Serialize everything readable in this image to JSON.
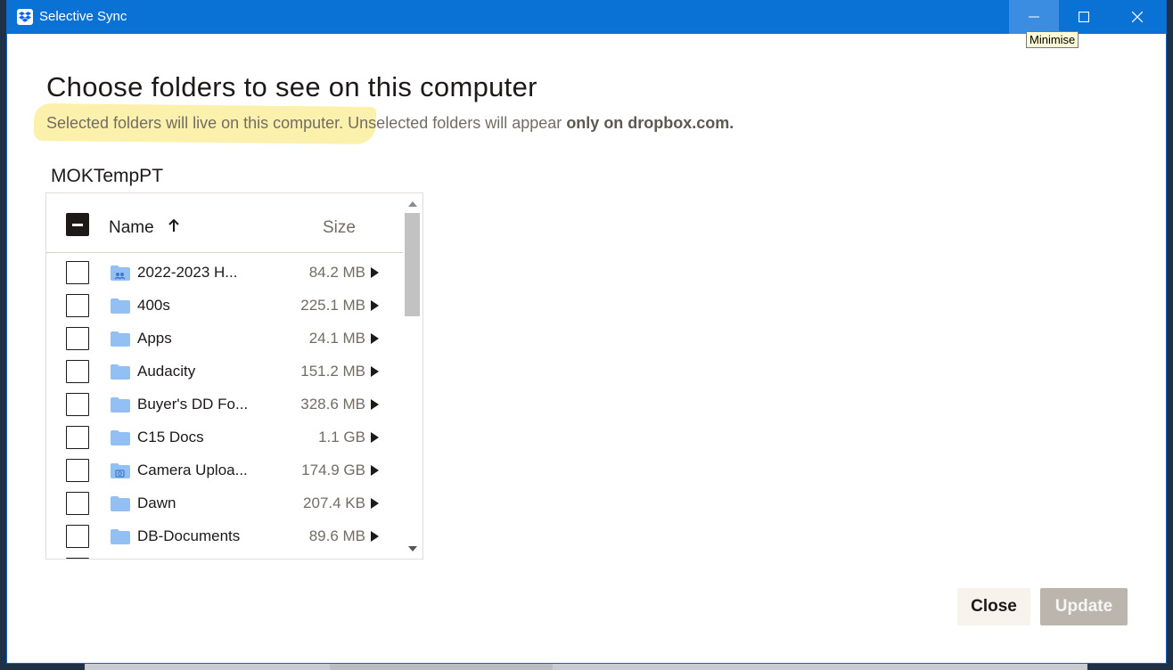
{
  "window": {
    "title": "Selective Sync",
    "tooltip": "Minimise"
  },
  "header": {
    "heading": "Choose folders to see on this computer",
    "subtitle_part1": "Selected folders will live on this computer.",
    "subtitle_part2": " Unselected folders will appear ",
    "subtitle_bold": "only on dropbox.com."
  },
  "account": "MOKTempPT",
  "table": {
    "col_name": "Name",
    "col_size": "Size",
    "rows": [
      {
        "name": "2022-2023 H...",
        "size": "84.2 MB",
        "icon": "shared-folder-icon"
      },
      {
        "name": "400s",
        "size": "225.1 MB",
        "icon": "folder-icon"
      },
      {
        "name": "Apps",
        "size": "24.1 MB",
        "icon": "folder-icon"
      },
      {
        "name": "Audacity",
        "size": "151.2 MB",
        "icon": "folder-icon"
      },
      {
        "name": "Buyer's DD Fo...",
        "size": "328.6 MB",
        "icon": "folder-icon"
      },
      {
        "name": "C15 Docs",
        "size": "1.1 GB",
        "icon": "folder-icon"
      },
      {
        "name": "Camera Uploa...",
        "size": "174.9 GB",
        "icon": "camera-folder-icon"
      },
      {
        "name": "Dawn",
        "size": "207.4 KB",
        "icon": "folder-icon"
      },
      {
        "name": "DB-Documents",
        "size": "89.6 MB",
        "icon": "folder-icon"
      }
    ]
  },
  "buttons": {
    "close": "Close",
    "update": "Update"
  },
  "colors": {
    "titlebar": "#0a72d4",
    "folder": "#92c0f5",
    "highlight": "#fbef9e"
  }
}
